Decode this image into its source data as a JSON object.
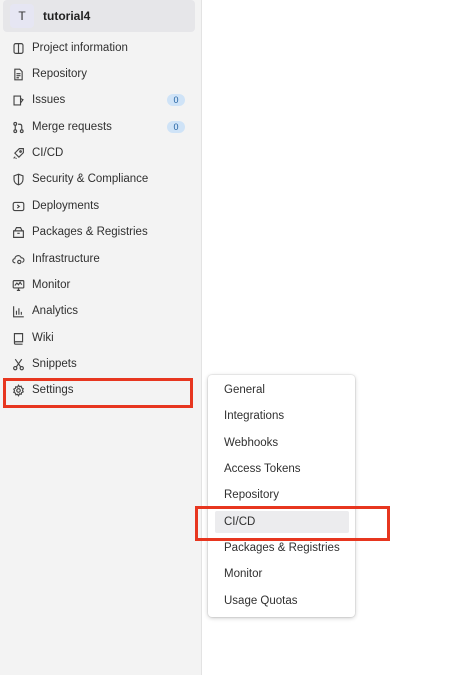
{
  "project": {
    "avatar_letter": "T",
    "name": "tutorial4"
  },
  "sidebar": {
    "items": [
      {
        "label": "Project information",
        "icon": "project-info-icon"
      },
      {
        "label": "Repository",
        "icon": "file-icon"
      },
      {
        "label": "Issues",
        "icon": "issues-icon",
        "badge": "0"
      },
      {
        "label": "Merge requests",
        "icon": "merge-request-icon",
        "badge": "0"
      },
      {
        "label": "CI/CD",
        "icon": "rocket-icon"
      },
      {
        "label": "Security & Compliance",
        "icon": "shield-icon"
      },
      {
        "label": "Deployments",
        "icon": "deployments-icon"
      },
      {
        "label": "Packages & Registries",
        "icon": "package-icon"
      },
      {
        "label": "Infrastructure",
        "icon": "cloud-gear-icon"
      },
      {
        "label": "Monitor",
        "icon": "monitor-icon"
      },
      {
        "label": "Analytics",
        "icon": "chart-icon"
      },
      {
        "label": "Wiki",
        "icon": "book-icon"
      },
      {
        "label": "Snippets",
        "icon": "scissors-icon"
      },
      {
        "label": "Settings",
        "icon": "gear-icon"
      }
    ]
  },
  "settings_flyout": {
    "items": [
      {
        "label": "General"
      },
      {
        "label": "Integrations"
      },
      {
        "label": "Webhooks"
      },
      {
        "label": "Access Tokens"
      },
      {
        "label": "Repository"
      },
      {
        "label": "CI/CD",
        "active": true
      },
      {
        "label": "Packages & Registries"
      },
      {
        "label": "Monitor"
      },
      {
        "label": "Usage Quotas"
      }
    ]
  },
  "colors": {
    "highlight": "#e7361f",
    "badge_bg": "#cfe3f7",
    "sidebar_bg": "#f3f3f3"
  }
}
